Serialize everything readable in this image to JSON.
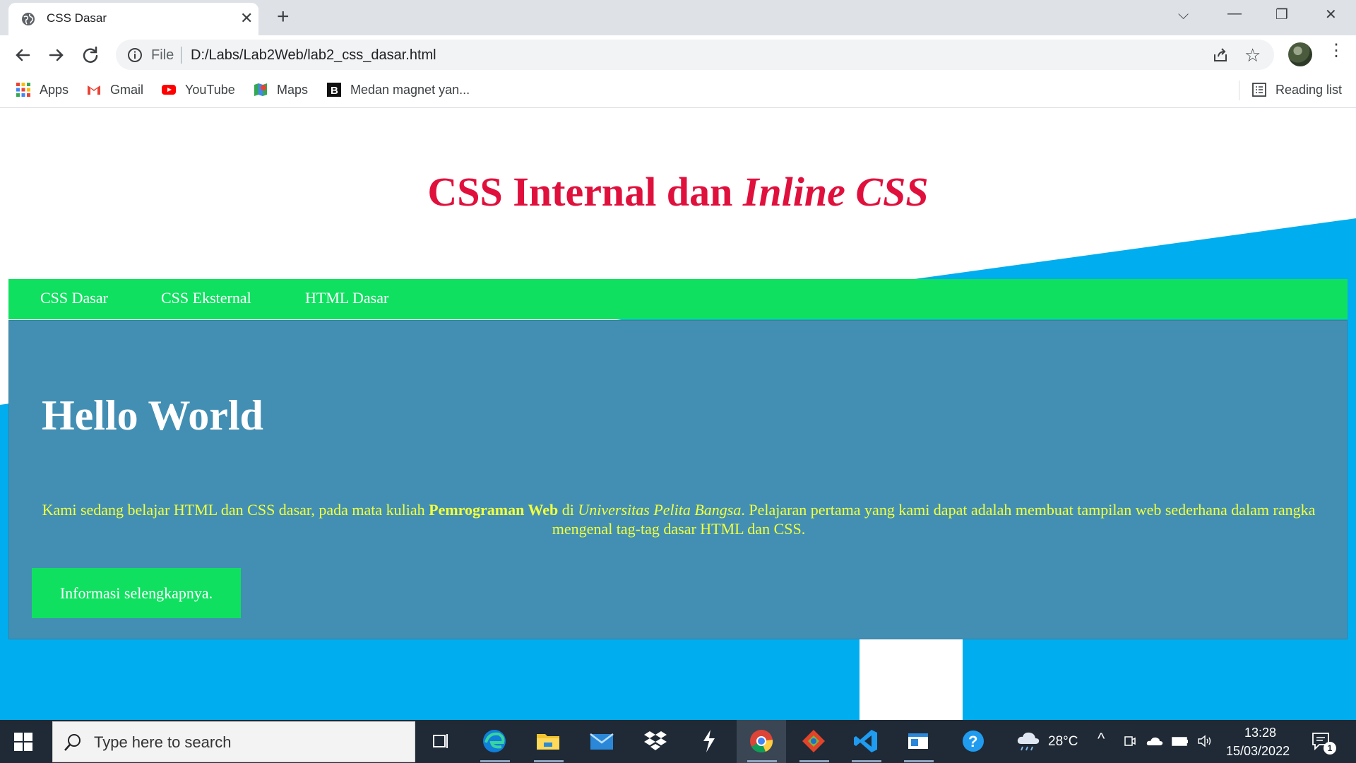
{
  "tab": {
    "title": "CSS Dasar",
    "close": "✕"
  },
  "new_tab": "+",
  "window_controls": {
    "dropdown": "⌵",
    "minimize": "—",
    "restore": "❐",
    "close": "✕"
  },
  "omnibox": {
    "scheme_label": "File",
    "url": "D:/Labs/Lab2Web/lab2_css_dasar.html"
  },
  "bookmarks": [
    {
      "label": "Apps",
      "icon": "apps-grid-icon"
    },
    {
      "label": "Gmail",
      "icon": "gmail-icon"
    },
    {
      "label": "YouTube",
      "icon": "youtube-icon"
    },
    {
      "label": "Maps",
      "icon": "maps-icon"
    },
    {
      "label": "Medan magnet yan...",
      "icon": "bookmark-b-icon"
    }
  ],
  "reading_list": "Reading list",
  "page": {
    "title_main": "CSS Internal dan ",
    "title_em": "Inline CSS",
    "nav": [
      "CSS Dasar",
      "CSS Eksternal",
      "HTML Dasar"
    ],
    "hero": {
      "heading": "Hello World",
      "text_1": "Kami sedang belajar HTML dan CSS dasar, pada mata kuliah ",
      "text_bold": "Pemrograman Web",
      "text_2": " di ",
      "text_italic": "Universitas Pelita Bangsa",
      "text_3": ". Pelajaran pertama yang kami dapat adalah membuat tampilan web sederhana dalam rangka mengenal tag-tag dasar HTML dan CSS.",
      "button": "Informasi selengkapnya."
    },
    "colors": {
      "title": "#e0103d",
      "nav_bg": "#10e060",
      "hero_bg": "#438fb3",
      "hero_text": "#f2ff3c",
      "bg_blue": "#00adef"
    }
  },
  "taskbar": {
    "search_placeholder": "Type here to search",
    "weather": "28°C",
    "time": "13:28",
    "date": "15/03/2022",
    "notifications": "1"
  }
}
